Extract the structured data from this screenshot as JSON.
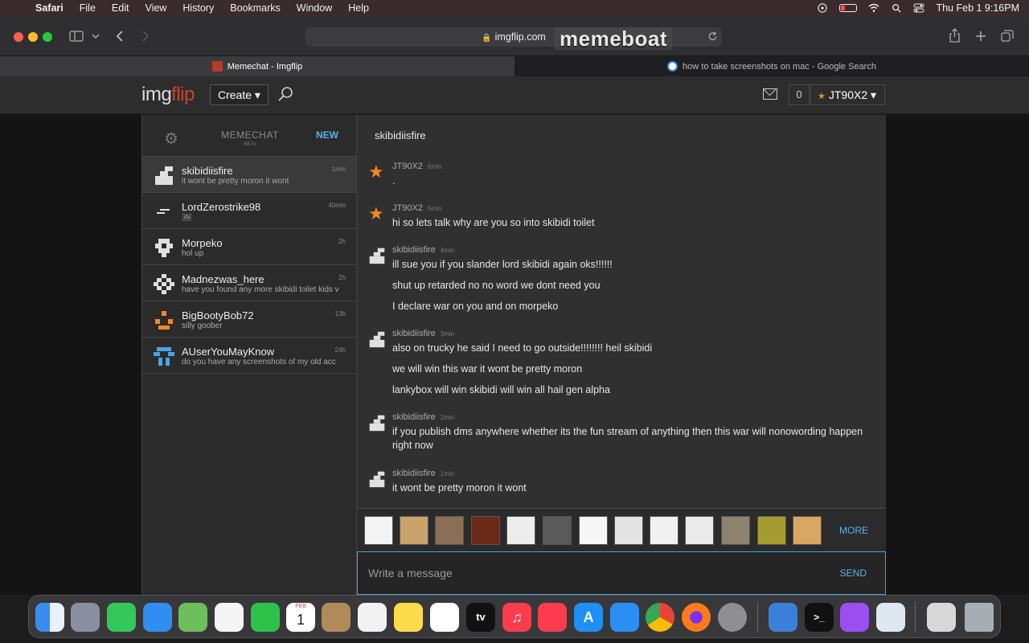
{
  "menubar": {
    "app": "Safari",
    "items": [
      "File",
      "Edit",
      "View",
      "History",
      "Bookmarks",
      "Window",
      "Help"
    ],
    "datetime": "Thu Feb 1  9:16PM"
  },
  "browser": {
    "url": "imgflip.com",
    "overlay": "memeboat",
    "tabs": [
      {
        "title": "Memechat - Imgflip",
        "active": true
      },
      {
        "title": "how to take screenshots on mac - Google Search",
        "active": false
      }
    ]
  },
  "site": {
    "logo_left": "img",
    "logo_right": "flip",
    "create_label": "Create ▾",
    "points": "0",
    "username": "JT90X2 ▾"
  },
  "sidebar": {
    "title": "MEMECHAT",
    "beta": "BETA",
    "new_label": "NEW",
    "conversations": [
      {
        "name": "skibidiisfire",
        "preview": "it wont be pretty moron it wont",
        "time": "1min",
        "avatar_color": "#e0e0e0"
      },
      {
        "name": "LordZerostrike98",
        "preview": "🖼",
        "time": "40min",
        "avatar_color": "#e0e0e0"
      },
      {
        "name": "Morpeko",
        "preview": "hol up",
        "time": "2h",
        "avatar_color": "#e0e0e0"
      },
      {
        "name": "Madnezwas_here",
        "preview": "have you found any more skibidi toilet kids v",
        "time": "2h",
        "avatar_color": "#e0e0e0"
      },
      {
        "name": "BigBootyBob72",
        "preview": "silly goober",
        "time": "13h",
        "avatar_color": "#f08a24"
      },
      {
        "name": "AUserYouMayKnow",
        "preview": "do you have any screenshots of my old acc",
        "time": "24h",
        "avatar_color": "#4aa3e8"
      }
    ]
  },
  "chat": {
    "title": "skibidiisfire",
    "messages": [
      {
        "author": "JT90X2",
        "time": "6min",
        "lines": [
          "."
        ]
      },
      {
        "author": "JT90X2",
        "time": "5min",
        "lines": [
          "hi so lets talk why are you so into skibidi toilet"
        ]
      },
      {
        "author": "skibidiisfire",
        "time": "4min",
        "lines": [
          "ill sue you if you slander lord skibidi again oks!!!!!!",
          "shut up retarded no no word we dont need you",
          "I declare war on you and on morpeko"
        ]
      },
      {
        "author": "skibidiisfire",
        "time": "3min",
        "lines": [
          "also on trucky he said I need to go outside!!!!!!!! heil skibidi",
          "we will win this war it wont be pretty moron",
          "lankybox will win skibidi will win all hail gen alpha"
        ]
      },
      {
        "author": "skibidiisfire",
        "time": "2min",
        "lines": [
          "if you publish dms anywhere whether its the fun stream of anything then this war will nonowording happen right now"
        ]
      },
      {
        "author": "skibidiisfire",
        "time": "1min",
        "lines": [
          "it wont be pretty moron it wont"
        ]
      }
    ],
    "more_label": "MORE",
    "input_placeholder": "Write a message",
    "send_label": "SEND"
  },
  "colors": {
    "accent_blue": "#5ab2e8",
    "star_orange": "#f28a1a",
    "logo_red": "#c8452e"
  },
  "dock": {
    "apps": [
      "finder",
      "launchpad",
      "messages",
      "mail",
      "maps",
      "photos",
      "facetime",
      "calendar",
      "contacts",
      "reminders",
      "notes",
      "freeform",
      "tv",
      "music",
      "news",
      "app-store",
      "safari",
      "chrome",
      "firefox",
      "system-settings",
      "xcode-tools",
      "terminal",
      "podcasts",
      "preview",
      "document",
      "trash"
    ],
    "calendar_month": "FEB",
    "calendar_day": "1",
    "tv_label": "tv"
  }
}
